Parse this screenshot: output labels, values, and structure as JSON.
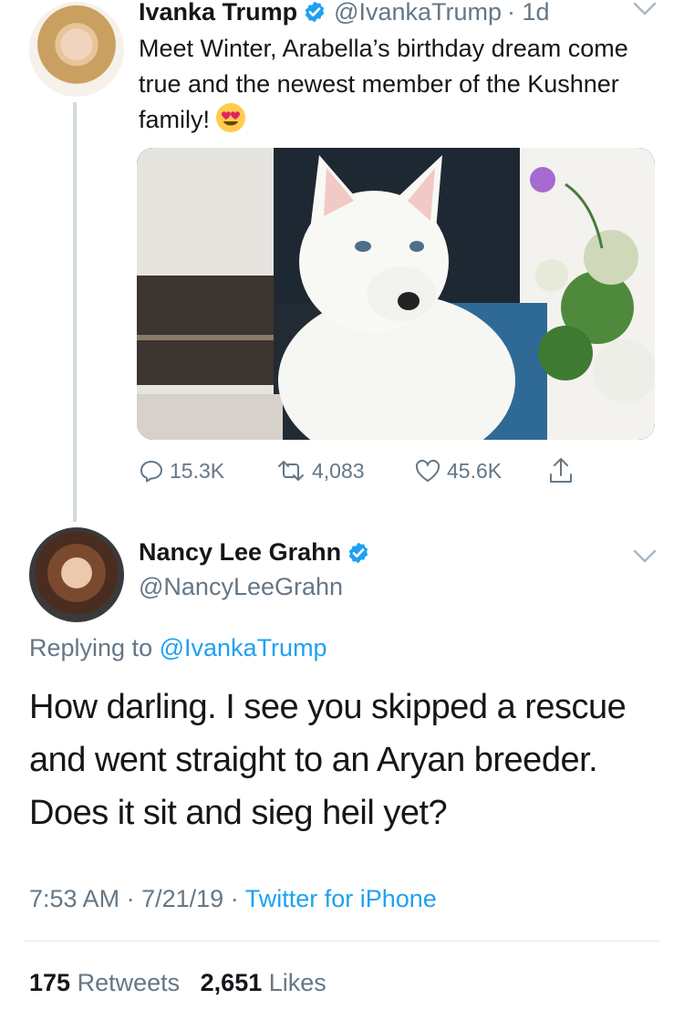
{
  "parent_tweet": {
    "author_name": "Ivanka Trump",
    "author_handle": "@IvankaTrump",
    "time_ago": "· 1d",
    "text": "Meet Winter, Arabella’s birthday dream come true and the newest member of the Kushner family!",
    "emoji": "heart-eyes-emoji",
    "image": "white-puppy-photo",
    "actions": {
      "replies": "15.3K",
      "retweets": "4,083",
      "likes": "45.6K"
    }
  },
  "reply_tweet": {
    "author_name": "Nancy Lee Grahn",
    "author_handle": "@NancyLeeGrahn",
    "replying_prefix": "Replying to",
    "replying_to": "@IvankaTrump",
    "text": "How darling. I see you skipped a rescue and went straight to an Aryan breeder. Does it sit and  sieg heil yet?",
    "time": "7:53 AM",
    "date": "7/21/19",
    "separator": "·",
    "source": "Twitter for iPhone",
    "retweet_count": "175",
    "retweet_label": "Retweets",
    "like_count": "2,651",
    "like_label": "Likes"
  },
  "colors": {
    "link": "#1da1f2",
    "secondary_text": "#657786",
    "verified": "#1da1f2",
    "thread_line": "#cfd9de"
  }
}
